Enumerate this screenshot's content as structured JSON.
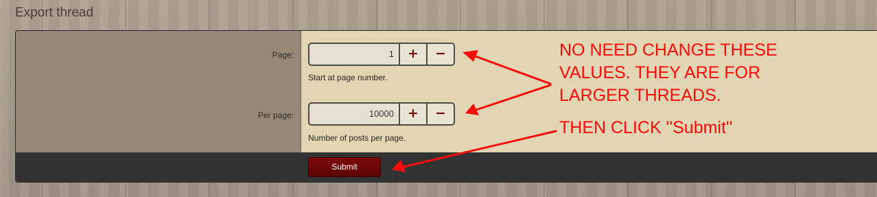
{
  "page": {
    "title": "Export thread"
  },
  "form": {
    "page": {
      "label": "Page:",
      "value": "1",
      "help": "Start at page number."
    },
    "per_page": {
      "label": "Per page:",
      "value": "10000",
      "help": "Number of posts per page."
    },
    "increment_symbol": "+",
    "decrement_symbol": "−",
    "submit_label": "Submit"
  },
  "annotation": {
    "color": "#ff0a0a",
    "note_lines": [
      "NO NEED CHANGE THESE",
      "VALUES. THEY ARE FOR",
      "LARGER THREADS."
    ],
    "submit_note": "THEN CLICK ''Submit''"
  },
  "colors": {
    "label_panel": "#958877",
    "input_panel": "#e2d5b4",
    "footer_bar": "#323232",
    "submit_button": "#6e0707",
    "stepper_symbol": "#7a0d0d"
  }
}
